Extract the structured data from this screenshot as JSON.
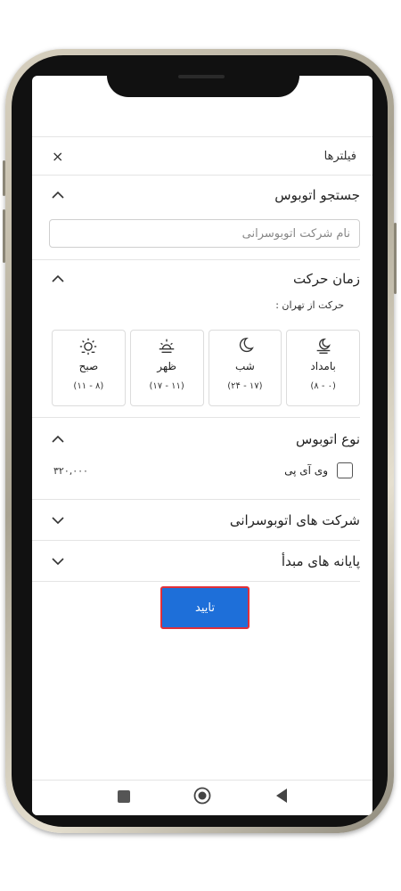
{
  "header": {
    "title": "فیلترها",
    "close_label": "×"
  },
  "bus_search": {
    "title": "جستجو اتوبوس",
    "placeholder": "نام شرکت اتوبوسرانی"
  },
  "departure_time": {
    "title": "زمان حرکت",
    "from_label": "حرکت از تهران :",
    "slots": [
      {
        "label": "بامداد",
        "range": "(۰ - ۸)",
        "icon": "moon-rise-icon"
      },
      {
        "label": "شب",
        "range": "(۱۷ - ۲۴)",
        "icon": "moon-icon"
      },
      {
        "label": "ظهر",
        "range": "(۱۱ - ۱۷)",
        "icon": "sunrise-icon"
      },
      {
        "label": "صبح",
        "range": "(۸ - ۱۱)",
        "icon": "sun-icon"
      }
    ]
  },
  "bus_type": {
    "title": "نوع اتوبوس",
    "options": [
      {
        "label": "وی آی پی",
        "price": "۳۲۰,۰۰۰",
        "checked": false
      }
    ]
  },
  "companies": {
    "title": "شرکت های اتوبوسرانی"
  },
  "terminals": {
    "title": "پایانه های مبدأ"
  },
  "confirm": {
    "label": "تایید",
    "color": "#1e6fd9",
    "border_color": "#e0303a"
  },
  "navbar": {
    "icons": [
      "recent-apps-icon",
      "home-icon",
      "back-icon"
    ]
  }
}
